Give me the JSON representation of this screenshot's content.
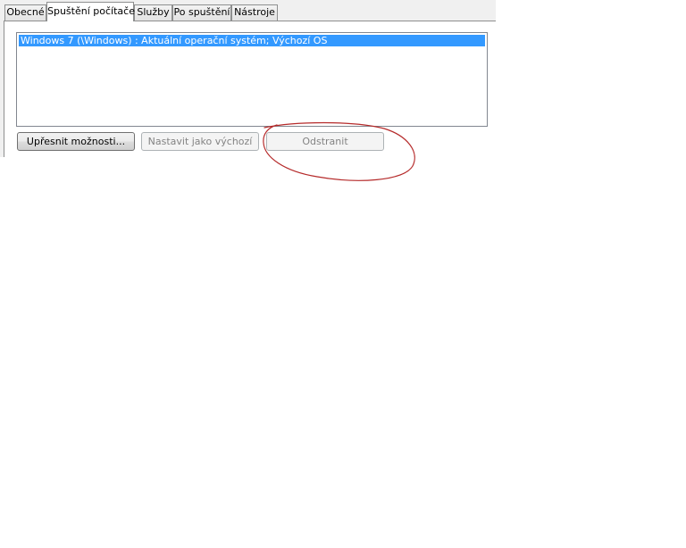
{
  "tabs": [
    {
      "label": "Obecné",
      "active": false
    },
    {
      "label": "Spuštění počítače",
      "active": true
    },
    {
      "label": "Služby",
      "active": false
    },
    {
      "label": "Po spuštění",
      "active": false
    },
    {
      "label": "Nástroje",
      "active": false
    }
  ],
  "os_list": {
    "items": [
      {
        "label": "Windows 7 (\\Windows) : Aktuální operační systém; Výchozí OS",
        "selected": true
      }
    ]
  },
  "buttons": {
    "advanced_label": "Upřesnit možnosti...",
    "set_default_label": "Nastavit jako výchozí",
    "delete_label": "Odstranit"
  },
  "colors": {
    "selection": "#3399ff",
    "annotation": "#b52a2a"
  }
}
